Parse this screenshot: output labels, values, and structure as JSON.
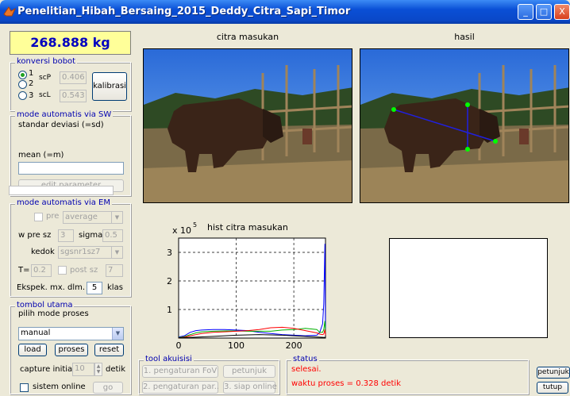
{
  "window": {
    "title": "Penelitian_Hibah_Bersaing_2015_Deddy_Citra_Sapi_Timor",
    "minimize": "_",
    "maximize": "□",
    "close": "X"
  },
  "weight": {
    "value": "268.888 kg"
  },
  "konversi": {
    "title": "konversi bobot",
    "opt1": "1",
    "opt2": "2",
    "opt3": "3",
    "scP_label": "scP",
    "scP_value": "0.406",
    "scL_label": "scL",
    "scL_value": "0.543",
    "kalibrasi": "kalibrasi"
  },
  "sw": {
    "title": "mode automatis via SW",
    "sd_label": "standar deviasi (=sd)",
    "sd_value": "",
    "mean_label": "mean (=m)",
    "mean_value": "",
    "edit_button": "edit parameter"
  },
  "em": {
    "title": "mode automatis via EM",
    "pre_label": "pre",
    "pre_select": "average",
    "wpre_label": "w pre sz",
    "wpre_value": "3",
    "sigma_label": "sigma",
    "sigma_value": "0.5",
    "kedok_label": "kedok",
    "kedok_select": "sgsnr1sz7",
    "t_label": "T=",
    "t_value": "0.2",
    "postsz_label": "post sz",
    "postsz_value": "7",
    "ekspek_label": "Ekspek. mx. dlm.",
    "ekspek_value": "5",
    "klas_label": "klas"
  },
  "tombol": {
    "title": "tombol utama",
    "pilih_label": "pilih mode proses",
    "mode_value": "manual",
    "load": "load",
    "proses": "proses",
    "reset": "reset",
    "capture_label": "capture initial",
    "capture_value": "10",
    "detik": "detik",
    "online_label": "sistem online",
    "go": "go"
  },
  "images": {
    "input_title": "citra masukan",
    "result_title": "hasil"
  },
  "hist": {
    "title": "hist citra masukan",
    "exponent_base": "x 10",
    "exponent": "5"
  },
  "chart_data": {
    "type": "line",
    "title": "hist citra masukan",
    "xlabel": "",
    "ylabel": "",
    "xlim": [
      0,
      255
    ],
    "ylim": [
      0,
      3.5
    ],
    "xticks": [
      0,
      100,
      200
    ],
    "yticks": [
      1,
      2,
      3
    ],
    "y_scale_label": "x 10^5",
    "grid": true,
    "series": [
      {
        "color": "#0000ff",
        "x": [
          0,
          10,
          20,
          30,
          40,
          60,
          80,
          100,
          120,
          140,
          160,
          180,
          200,
          220,
          240,
          245,
          250,
          252,
          254,
          255
        ],
        "y": [
          0.04,
          0.08,
          0.2,
          0.26,
          0.28,
          0.3,
          0.3,
          0.28,
          0.26,
          0.2,
          0.16,
          0.12,
          0.1,
          0.08,
          0.1,
          0.2,
          0.5,
          1.2,
          3.3,
          0.2
        ]
      },
      {
        "color": "#00b000",
        "x": [
          0,
          10,
          20,
          30,
          40,
          60,
          80,
          100,
          120,
          140,
          160,
          180,
          200,
          220,
          240,
          245,
          250,
          252,
          254,
          255
        ],
        "y": [
          0.02,
          0.05,
          0.12,
          0.18,
          0.22,
          0.24,
          0.25,
          0.25,
          0.24,
          0.24,
          0.24,
          0.28,
          0.3,
          0.34,
          0.3,
          0.2,
          0.2,
          0.3,
          0.6,
          0.2
        ]
      },
      {
        "color": "#ff0000",
        "x": [
          0,
          10,
          20,
          30,
          40,
          60,
          80,
          100,
          120,
          140,
          160,
          180,
          200,
          220,
          240,
          245,
          250,
          252,
          254,
          255
        ],
        "y": [
          0.01,
          0.03,
          0.08,
          0.12,
          0.16,
          0.2,
          0.22,
          0.24,
          0.26,
          0.3,
          0.36,
          0.38,
          0.34,
          0.26,
          0.18,
          0.14,
          0.12,
          0.14,
          0.3,
          0.1
        ]
      },
      {
        "color": "#000000",
        "x": [
          0,
          30,
          60,
          100,
          140,
          180,
          220,
          255
        ],
        "y": [
          0.01,
          0.03,
          0.06,
          0.1,
          0.12,
          0.1,
          0.06,
          0.02
        ]
      }
    ]
  },
  "akuisisi": {
    "title": "tool akuisisi",
    "fov": "1. pengaturan FoV",
    "petunjuk": "petunjuk",
    "par": "2. pengaturan par..",
    "siap": "3. siap online"
  },
  "status": {
    "title": "status",
    "line1": "selesai.",
    "line2": "waktu proses = 0.328 detik"
  },
  "right": {
    "petunjuk": "petunjuk",
    "tutup": "tutup"
  },
  "colors": {
    "titlebar": "#0a4fd6",
    "weight_bg": "#ffff99",
    "weight_text": "#0000c0",
    "status_text": "#ff0000",
    "group_title": "#0000b0"
  }
}
